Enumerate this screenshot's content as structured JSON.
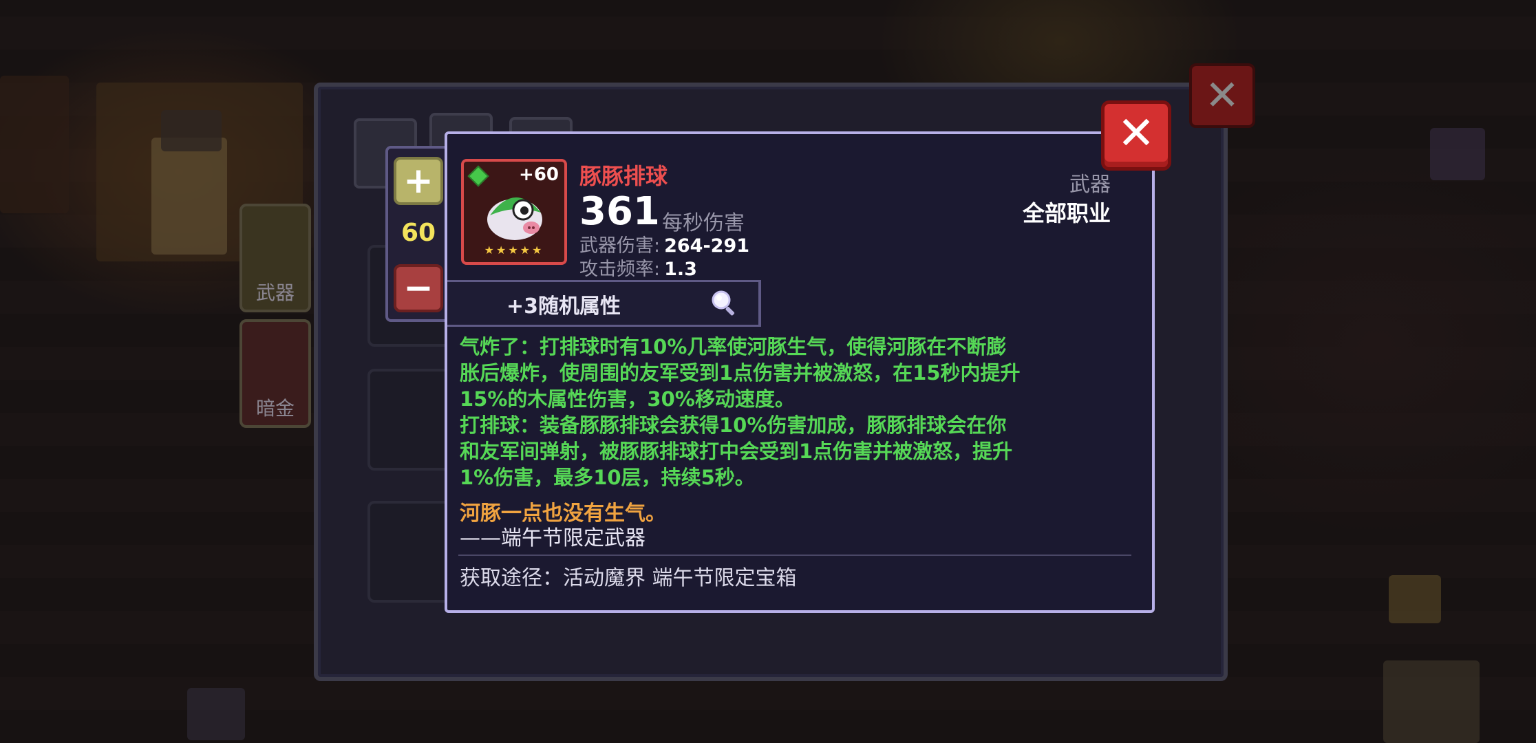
{
  "inventory": {
    "side_tabs": [
      {
        "label": "武器"
      },
      {
        "label": "暗金"
      }
    ]
  },
  "upgrade": {
    "count": "60"
  },
  "item": {
    "name": "豚豚排球",
    "enhance": "+60",
    "stars": "★★★★★",
    "dps": "361",
    "dps_label": "每秒伤害",
    "damage_label": "武器伤害:",
    "damage_value": "264-291",
    "rate_label": "攻击频率:",
    "rate_value": "1.3",
    "type": "武器",
    "class": "全部职业",
    "random_attr": "+3随机属性",
    "description": [
      "气炸了：打排球时有10%几率使河豚生气，使得河豚在不断膨",
      "胀后爆炸，使周围的友军受到1点伤害并被激怒，在15秒内提升",
      "15%的木属性伤害，30%移动速度。",
      "打排球：装备豚豚排球会获得10%伤害加成，豚豚排球会在你",
      "和友军间弹射，被豚豚排球打中会受到1点伤害并被激怒，提升",
      "1%伤害，最多10层，持续5秒。"
    ],
    "flavor": "河豚一点也没有生气。",
    "flavor_source": "——端午节限定武器",
    "source": "获取途径：活动魔界 端午节限定宝箱"
  },
  "colors": {
    "name_red": "#ee4f4f",
    "desc_green": "#56d856",
    "flavor_orange": "#f0a340",
    "count_yellow": "#f3e35c",
    "card_border": "#b7b0e8"
  }
}
